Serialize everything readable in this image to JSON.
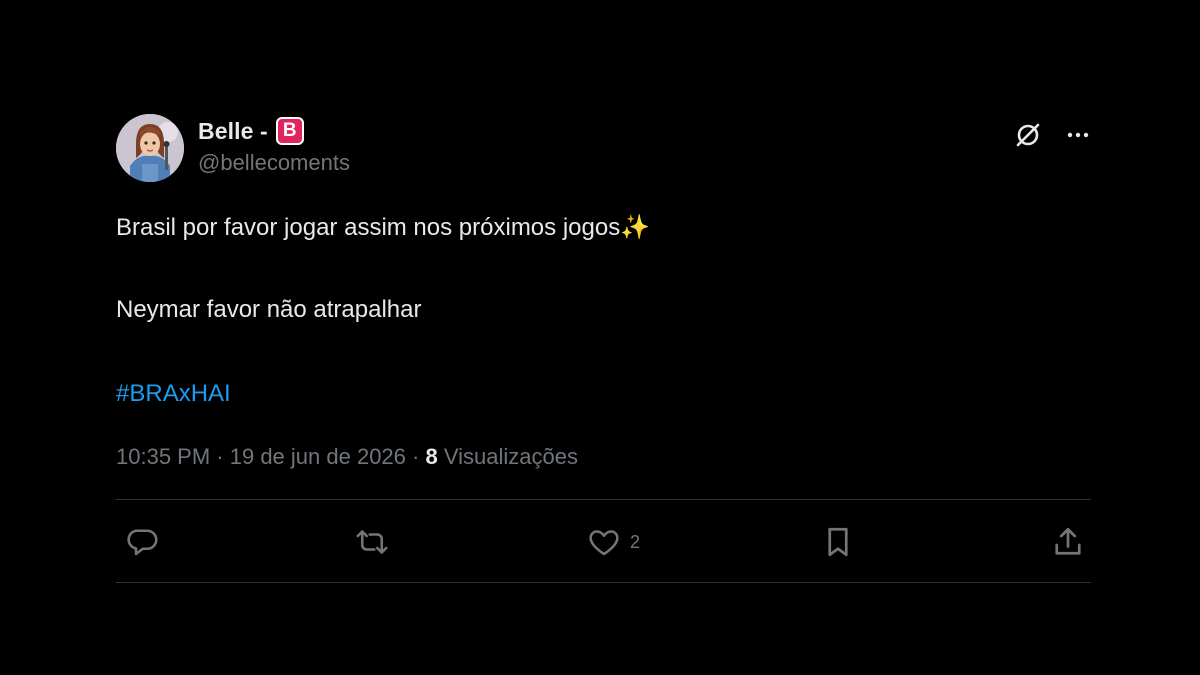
{
  "tweet": {
    "author": {
      "display_name": "Belle -",
      "badge_letter": "B",
      "handle": "@bellecoments"
    },
    "text_line1": "Brasil por favor jogar assim nos próximos jogos✨",
    "text_line2": "Neymar favor não atrapalhar",
    "hashtag": "#BRAxHAI",
    "meta": {
      "time": "10:35 PM",
      "separator": " · ",
      "date": "19 de jun de 2026",
      "views_count": "8",
      "views_label": " Visualizações"
    },
    "actions": {
      "reply_icon": "reply-icon",
      "retweet_icon": "retweet-icon",
      "like_icon": "heart-icon",
      "like_count": "2",
      "bookmark_icon": "bookmark-icon",
      "share_icon": "share-icon"
    },
    "top_icons": [
      "grok-icon",
      "more-icon"
    ]
  },
  "colors": {
    "background": "#000000",
    "text": "#e7e9ea",
    "muted": "#71767b",
    "link": "#1d9bf0",
    "badge": "#e0245e",
    "divider": "#2f3336"
  }
}
